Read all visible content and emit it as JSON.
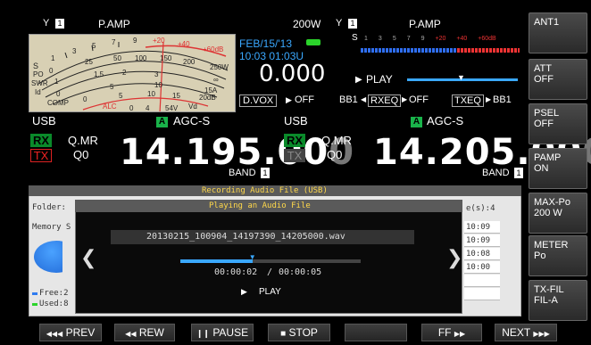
{
  "top": {
    "ant_a": "1",
    "pamp_left": "P.AMP",
    "power": "200W",
    "ant_b": "1",
    "pamp_right": "P.AMP"
  },
  "meter": {
    "labels": [
      "S",
      "PO",
      "SWR",
      "Id",
      "COMP",
      "ALC",
      "Vd"
    ],
    "scale_s": [
      "1",
      "3",
      "5",
      "7",
      "9",
      "+20",
      "+40",
      "+60dB"
    ],
    "scale_po": [
      "0",
      "25",
      "50",
      "100",
      "150",
      "200",
      "250W"
    ],
    "scale_swr": [
      "1",
      "1.5",
      "2",
      "3",
      "∞"
    ],
    "scale_id": [
      "0",
      "5",
      "10",
      "15A"
    ],
    "scale_comp": [
      "0",
      "5",
      "10",
      "15",
      "20dB"
    ],
    "scale_vd": [
      "0",
      "4",
      "54V",
      "Vd"
    ]
  },
  "status": {
    "date": "FEB/15/'13",
    "time": "10:03 01:03U",
    "offset": "0.000",
    "dvox": "D.VOX",
    "dvox_state": "OFF",
    "play": "PLAY",
    "bb1": "BB1",
    "rxeq": "RXEQ",
    "rxeq_state": "OFF",
    "txeq": "TXEQ",
    "bb1b": "BB1"
  },
  "vfo_a": {
    "mode": "USB",
    "agc_tag": "A",
    "agc": "AGC-S",
    "rx": "RX",
    "tx": "TX",
    "qmr": "Q.MR",
    "q0": "Q0",
    "freq_main": "14.195.00",
    "freq_dim": "0",
    "band": "BAND",
    "band_num": "1"
  },
  "vfo_b": {
    "mode": "USB",
    "agc_tag": "A",
    "agc": "AGC-S",
    "rx": "RX",
    "tx": "TX",
    "qmr": "Q.MR",
    "q0": "Q0",
    "freq_main": "14.205.00",
    "freq_dim": "0",
    "band": "BAND",
    "band_num": "1"
  },
  "recording_dialog": {
    "title": "Recording Audio File (USB)",
    "folder_label": "Folder:",
    "memory_label": "Memory S",
    "files_label": "e(s):4",
    "free_label": "Free:2",
    "used_label": "Used:8",
    "list_times": [
      "10:09",
      "10:09",
      "10:08",
      "10:00",
      "",
      ""
    ]
  },
  "play_dialog": {
    "title": "Playing an Audio File",
    "filename": "20130215_100904_14197390_14205000.wav",
    "elapsed": "00:00:02",
    "separator": "/",
    "total": "00:00:05",
    "state": "PLAY",
    "progress": 0.4
  },
  "softkeys": [
    {
      "line1": "ANT1",
      "line2": ""
    },
    {
      "line1": "ATT",
      "line2": "OFF"
    },
    {
      "line1": "PSEL",
      "line2": "OFF"
    },
    {
      "line1": "PAMP",
      "line2": "ON"
    },
    {
      "line1": "MAX-Po",
      "line2": "200 W"
    },
    {
      "line1": "METER",
      "line2": "Po"
    },
    {
      "line1": "TX-FIL",
      "line2": "FIL-A"
    }
  ],
  "bottom_keys": [
    {
      "icon": "◀◀◀",
      "label": "PREV"
    },
    {
      "icon": "◀◀",
      "label": "REW"
    },
    {
      "icon": "❙❙",
      "label": "PAUSE"
    },
    {
      "icon": "■",
      "label": "STOP"
    },
    {
      "icon": "",
      "label": ""
    },
    {
      "icon": "▶▶",
      "label": "FF"
    },
    {
      "icon": "▶▶▶",
      "label": "NEXT"
    }
  ]
}
